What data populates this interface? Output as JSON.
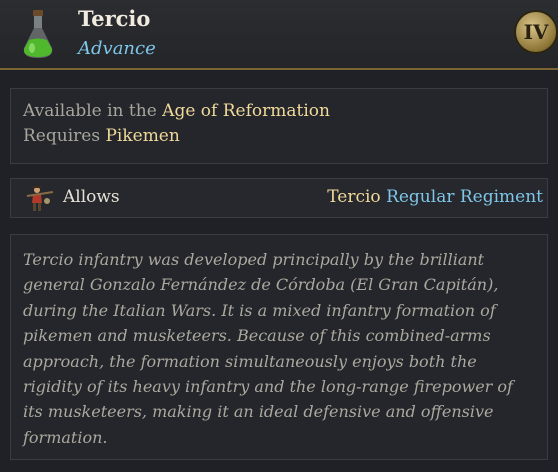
{
  "header": {
    "title": "Tercio",
    "subtitle": "Advance",
    "icon": "green-potion-flask-icon",
    "era_badge": "IV"
  },
  "requirements": {
    "available_prefix": "Available in the",
    "available_value": "Age of Reformation",
    "requires_prefix": "Requires",
    "requires_value": "Pikemen"
  },
  "allows": {
    "icon": "musketeer-unit-icon",
    "label": "Allows",
    "unit_name": "Tercio",
    "unit_type": "Regular Regiment"
  },
  "description": "Tercio infantry was developed principally by the brilliant general Gonzalo Fernández de Córdoba (El Gran Capitán), during the Italian Wars. It is a mixed infantry formation of pikemen and musketeers. Because of this combined-arms approach, the formation simultaneously enjoys both the rigidity of its heavy infantry and the long-range firepower of its musketeers, making it an ideal defensive and offensive formation.",
  "colors": {
    "highlight": "#f0d99a",
    "link_blue": "#7fc6e8",
    "header_border": "#7a6432"
  }
}
